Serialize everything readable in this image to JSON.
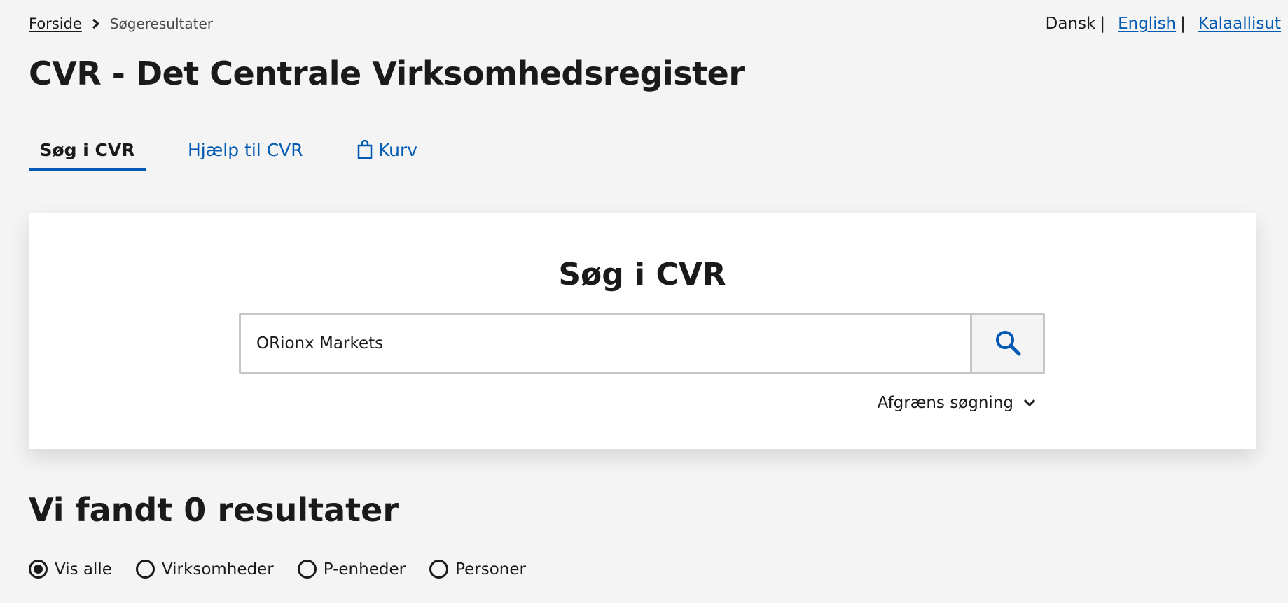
{
  "breadcrumb": {
    "home": "Forside",
    "current": "Søgeresultater"
  },
  "language": {
    "current": "Dansk",
    "english": "English",
    "greenlandic": "Kalaallisut"
  },
  "page_title": "CVR - Det Centrale Virksomhedsregister",
  "tabs": [
    {
      "label": "Søg i CVR",
      "active": true
    },
    {
      "label": "Hjælp til CVR",
      "active": false
    },
    {
      "label": "Kurv",
      "active": false,
      "icon": "shopping-bag-icon"
    }
  ],
  "search": {
    "heading": "Søg i CVR",
    "value": "ORionx Markets",
    "button_icon": "search-icon",
    "refine_label": "Afgræns søgning"
  },
  "results": {
    "title": "Vi fandt 0 resultater",
    "filters": [
      {
        "label": "Vis alle",
        "selected": true
      },
      {
        "label": "Virksomheder",
        "selected": false
      },
      {
        "label": "P-enheder",
        "selected": false
      },
      {
        "label": "Personer",
        "selected": false
      }
    ]
  },
  "colors": {
    "accent": "#0059b3",
    "background": "#f4f4f4",
    "text": "#1a1a1a"
  }
}
